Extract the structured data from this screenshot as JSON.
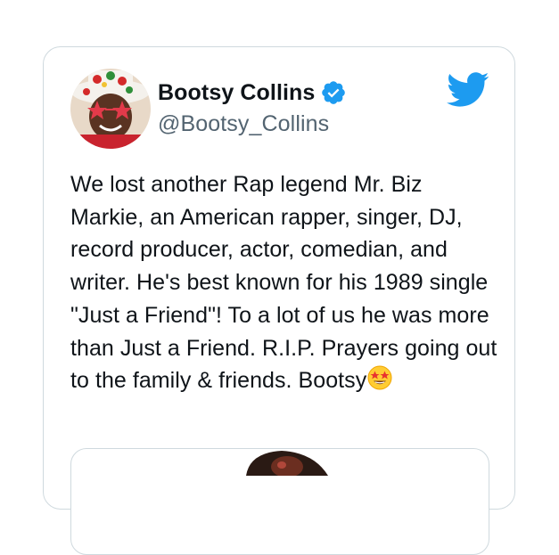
{
  "tweet": {
    "author": {
      "display_name": "Bootsy Collins",
      "handle": "@Bootsy_Collins",
      "verified": true,
      "avatar_icon": "profile-avatar"
    },
    "platform_icon": "twitter-bird-icon",
    "text": "We lost another Rap legend Mr. Biz Markie, an American rapper, singer, DJ, record producer, actor, comedian, and writer. He's best known for his 1989 single \"Just a Friend\"! To a lot of us he was more than Just a Friend. R.I.P. Prayers going out to the family & friends. Bootsy",
    "emoji": "star-struck-emoji",
    "media": {
      "type": "image"
    }
  },
  "colors": {
    "text_primary": "#0f1419",
    "text_secondary": "#536471",
    "twitter_blue": "#1d9bf0",
    "border": "#cfd9de"
  }
}
